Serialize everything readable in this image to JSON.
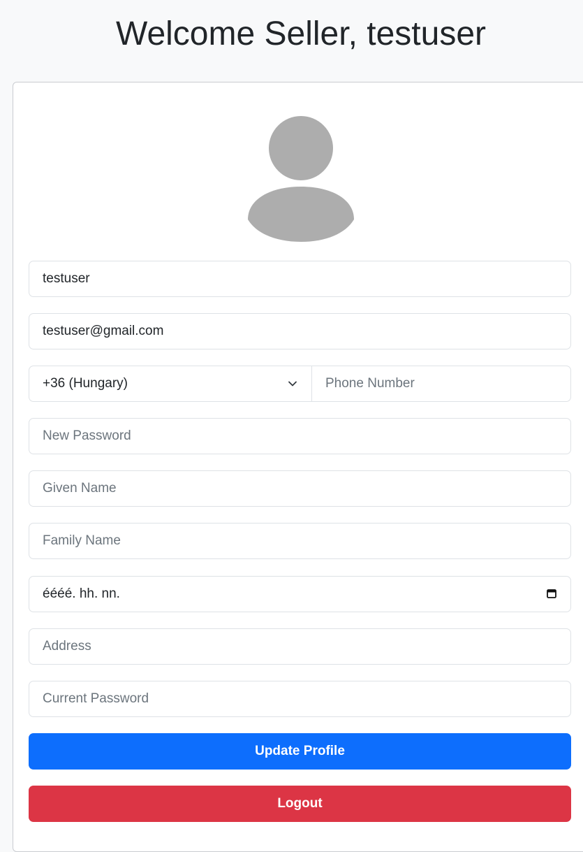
{
  "header": {
    "title": "Welcome Seller, testuser"
  },
  "avatar": {
    "icon": "user-avatar-icon",
    "color": "#adadad"
  },
  "form": {
    "username": {
      "value": "testuser"
    },
    "email": {
      "value": "testuser@gmail.com"
    },
    "country_code": {
      "selected": "+36 (Hungary)"
    },
    "phone": {
      "placeholder": "Phone Number"
    },
    "new_password": {
      "placeholder": "New Password"
    },
    "given_name": {
      "placeholder": "Given Name"
    },
    "family_name": {
      "placeholder": "Family Name"
    },
    "birth_date": {
      "placeholder": "éééé. hh. nn."
    },
    "address": {
      "placeholder": "Address"
    },
    "current_password": {
      "placeholder": "Current Password"
    }
  },
  "actions": {
    "update_label": "Update Profile",
    "logout_label": "Logout"
  },
  "colors": {
    "primary": "#0d6efd",
    "danger": "#dc3545",
    "background": "#f8f9fa"
  }
}
